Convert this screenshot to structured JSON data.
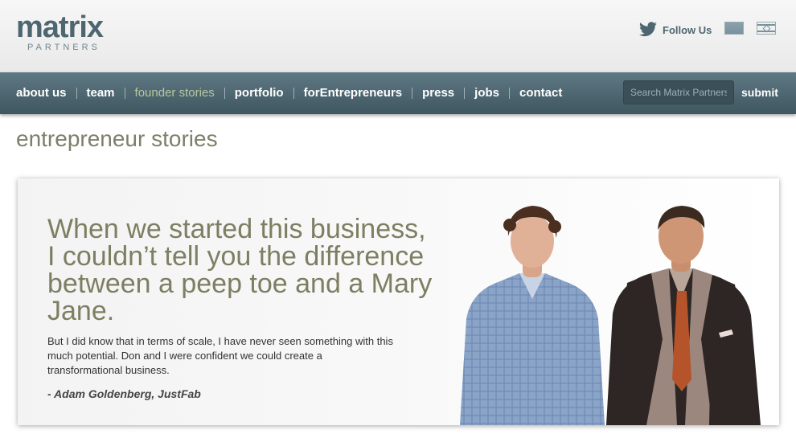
{
  "header": {
    "logo_main": "matrix",
    "logo_sub": "PARTNERS",
    "follow_label": "Follow Us",
    "follow_icon": "twitter-bird-icon",
    "flags": [
      "china-flag-icon",
      "israel-flag-icon"
    ]
  },
  "nav": {
    "items": [
      {
        "label": "about us",
        "active": false
      },
      {
        "label": "team",
        "active": false
      },
      {
        "label": "founder stories",
        "active": true
      },
      {
        "label": "portfolio",
        "active": false
      },
      {
        "label": "forEntrepreneurs",
        "active": false
      },
      {
        "label": "press",
        "active": false
      },
      {
        "label": "jobs",
        "active": false
      },
      {
        "label": "contact",
        "active": false
      }
    ],
    "search_placeholder": "Search Matrix Partners",
    "submit_label": "submit"
  },
  "page": {
    "title": "entrepreneur stories"
  },
  "feature": {
    "quote": "When we started this business, I couldn’t tell you the difference between a peep toe and a Mary Jane.",
    "body": "But I did know that in terms of scale, I have never seen something with this much potential. Don and I were confident we could create a transformational business.",
    "attribution": "- Adam Goldenberg, JustFab"
  },
  "colors": {
    "nav_top": "#5f7984",
    "nav_bottom": "#3e5660",
    "active_nav": "#b8c79e",
    "quote_text": "#7e7e62",
    "logo": "#4d6670"
  }
}
